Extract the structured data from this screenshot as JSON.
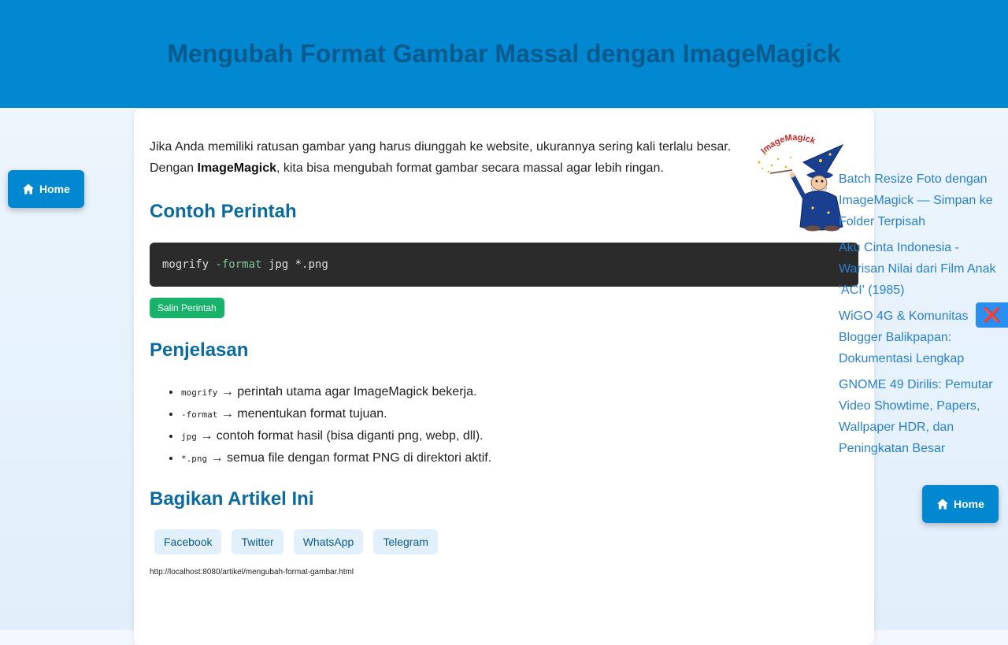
{
  "header": {
    "title": "Mengubah Format Gambar Massal dengan ImageMagick"
  },
  "nav": {
    "home_label": "Home",
    "home_label_right": "Home",
    "close_symbol": "❌"
  },
  "article": {
    "intro_before": "Jika Anda memiliki ratusan gambar yang harus diunggah ke website, ukurannya sering kali terlalu besar. Dengan ",
    "intro_bold": "ImageMagick",
    "intro_after": ", kita bisa mengubah format gambar secara massal agar lebih ringan.",
    "section_command": "Contoh Perintah",
    "code": {
      "cmd": "mogrify",
      "flag": "-format",
      "rest": "jpg *.png"
    },
    "copy_button": "Salin Perintah",
    "section_explain": "Penjelasan",
    "explain_items": [
      {
        "code": "mogrify",
        "text": "→ perintah utama agar ImageMagick bekerja."
      },
      {
        "code": "-format",
        "text": "→ menentukan format tujuan."
      },
      {
        "code": "jpg",
        "text": "→ contoh format hasil (bisa diganti png, webp, dll)."
      },
      {
        "code": "*.png",
        "text": "→ semua file dengan format PNG di direktori aktif."
      }
    ],
    "section_share": "Bagikan Artikel Ini",
    "share_buttons": [
      "Facebook",
      "Twitter",
      "WhatsApp",
      "Telegram"
    ],
    "url": "http://localhost:8080/artikel/mengubah-format-gambar.html"
  },
  "mascot": {
    "logo_text": "ImageMagick"
  },
  "sidebar": {
    "links": [
      "Batch Resize Foto dengan ImageMagick — Simpan ke Folder Terpisah",
      "Aku Cinta Indonesia - Warisan Nilai dari Film Anak 'ACI' (1985)",
      "WiGO 4G & Komunitas Blogger Balikpapan: Dokumentasi Lengkap",
      "GNOME 49 Dirilis: Pemutar Video Showtime, Papers, Wallpaper HDR, dan Peningkatan Besar"
    ]
  },
  "colors": {
    "header_bg": "#0288d1",
    "title": "#0b5a8c",
    "heading": "#0b6aa0",
    "link": "#2b80cf",
    "copy_button": "#19b26b"
  }
}
